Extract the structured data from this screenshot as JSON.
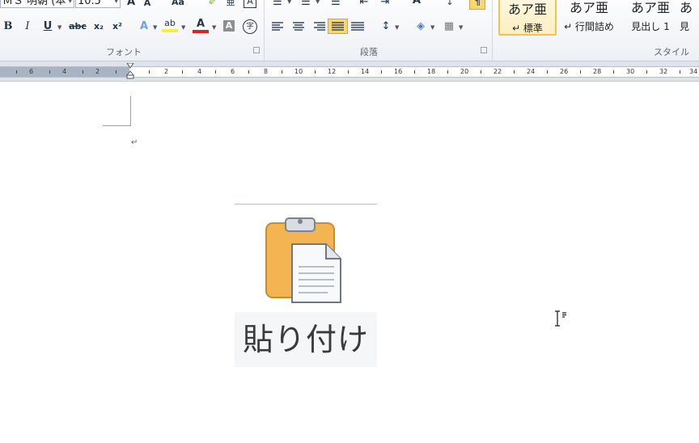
{
  "ribbon": {
    "font_group": {
      "label": "フォント",
      "font_name": "ＭＳ 明朝 (本",
      "font_size": "10.5",
      "buttons": {
        "grow": "A",
        "shrink": "A",
        "change_case": "Aa",
        "clear_format": "✐",
        "phonetic": "亜",
        "char_border": "A",
        "bold": "B",
        "italic": "I",
        "underline": "U",
        "strike": "abc",
        "subscript": "x₂",
        "superscript": "x²",
        "text_effect": "A",
        "highlight": "ab",
        "font_color": "A",
        "char_shading": "A",
        "enclose": "字"
      }
    },
    "paragraph_group": {
      "label": "段落",
      "buttons": {
        "bullets": "☰",
        "numbering": "☰",
        "multilevel": "☰",
        "decrease_indent": "⇤",
        "increase_indent": "⇥",
        "line_spacing": "↕",
        "shading": "◈",
        "borders": "▦",
        "sort": "↓",
        "show_marks": "¶"
      }
    },
    "styles_group": {
      "label": "スタイル",
      "items": [
        {
          "sample": "あア亜",
          "name": "↵ 標準",
          "selected": true
        },
        {
          "sample": "あア亜",
          "name": "↵ 行間詰め",
          "selected": false
        },
        {
          "sample": "あア亜",
          "name": "見出し 1",
          "selected": false
        },
        {
          "sample": "あ",
          "name": "見",
          "selected": false
        }
      ]
    },
    "colors": {
      "accent": "#f0c24f",
      "ribbon_bg": "#edf0f5"
    }
  },
  "ruler": {
    "numbers": [
      "6",
      "4",
      "2",
      "2",
      "4",
      "6",
      "8",
      "10",
      "12",
      "14",
      "16",
      "18",
      "20",
      "22",
      "24",
      "26",
      "28",
      "30",
      "32",
      "34"
    ]
  },
  "document": {
    "paragraph_mark": "↵",
    "paste_tooltip": {
      "label": "貼り付け",
      "icon": "clipboard-paste-icon"
    },
    "cursor_icon": "ibeam-cursor-icon"
  }
}
